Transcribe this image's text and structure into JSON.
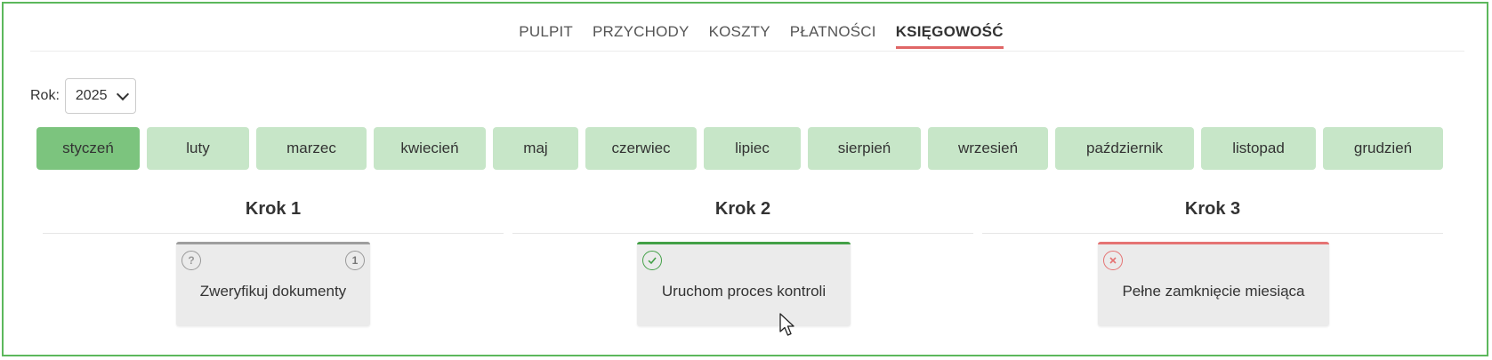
{
  "nav": {
    "items": [
      {
        "label": "PULPIT"
      },
      {
        "label": "PRZYCHODY"
      },
      {
        "label": "KOSZTY"
      },
      {
        "label": "PŁATNOŚCI"
      },
      {
        "label": "KSIĘGOWOŚĆ"
      }
    ],
    "active": "KSIĘGOWOŚĆ"
  },
  "year": {
    "label": "Rok:",
    "value": "2025"
  },
  "months": {
    "items": [
      "styczeń",
      "luty",
      "marzec",
      "kwiecień",
      "maj",
      "czerwiec",
      "lipiec",
      "sierpień",
      "wrzesień",
      "październik",
      "listopad",
      "grudzień"
    ],
    "active": "styczeń"
  },
  "colors": {
    "accent": "#5cb85c",
    "tab": "#c7e6c8",
    "tab_active": "#7cc47e",
    "nav_underline": "#e06666",
    "success": "#43a047",
    "error": "#e57373",
    "neutral": "#999999"
  },
  "steps": [
    {
      "title": "Krok 1",
      "card": {
        "text": "Zweryfikuj dokumenty",
        "status_icon": "question-icon",
        "badge": "1",
        "status": "neutral"
      }
    },
    {
      "title": "Krok 2",
      "card": {
        "text": "Uruchom proces kontroli",
        "status_icon": "check-icon",
        "status": "success"
      }
    },
    {
      "title": "Krok 3",
      "card": {
        "text": "Pełne zamknięcie miesiąca",
        "status_icon": "close-icon",
        "status": "error"
      }
    }
  ]
}
